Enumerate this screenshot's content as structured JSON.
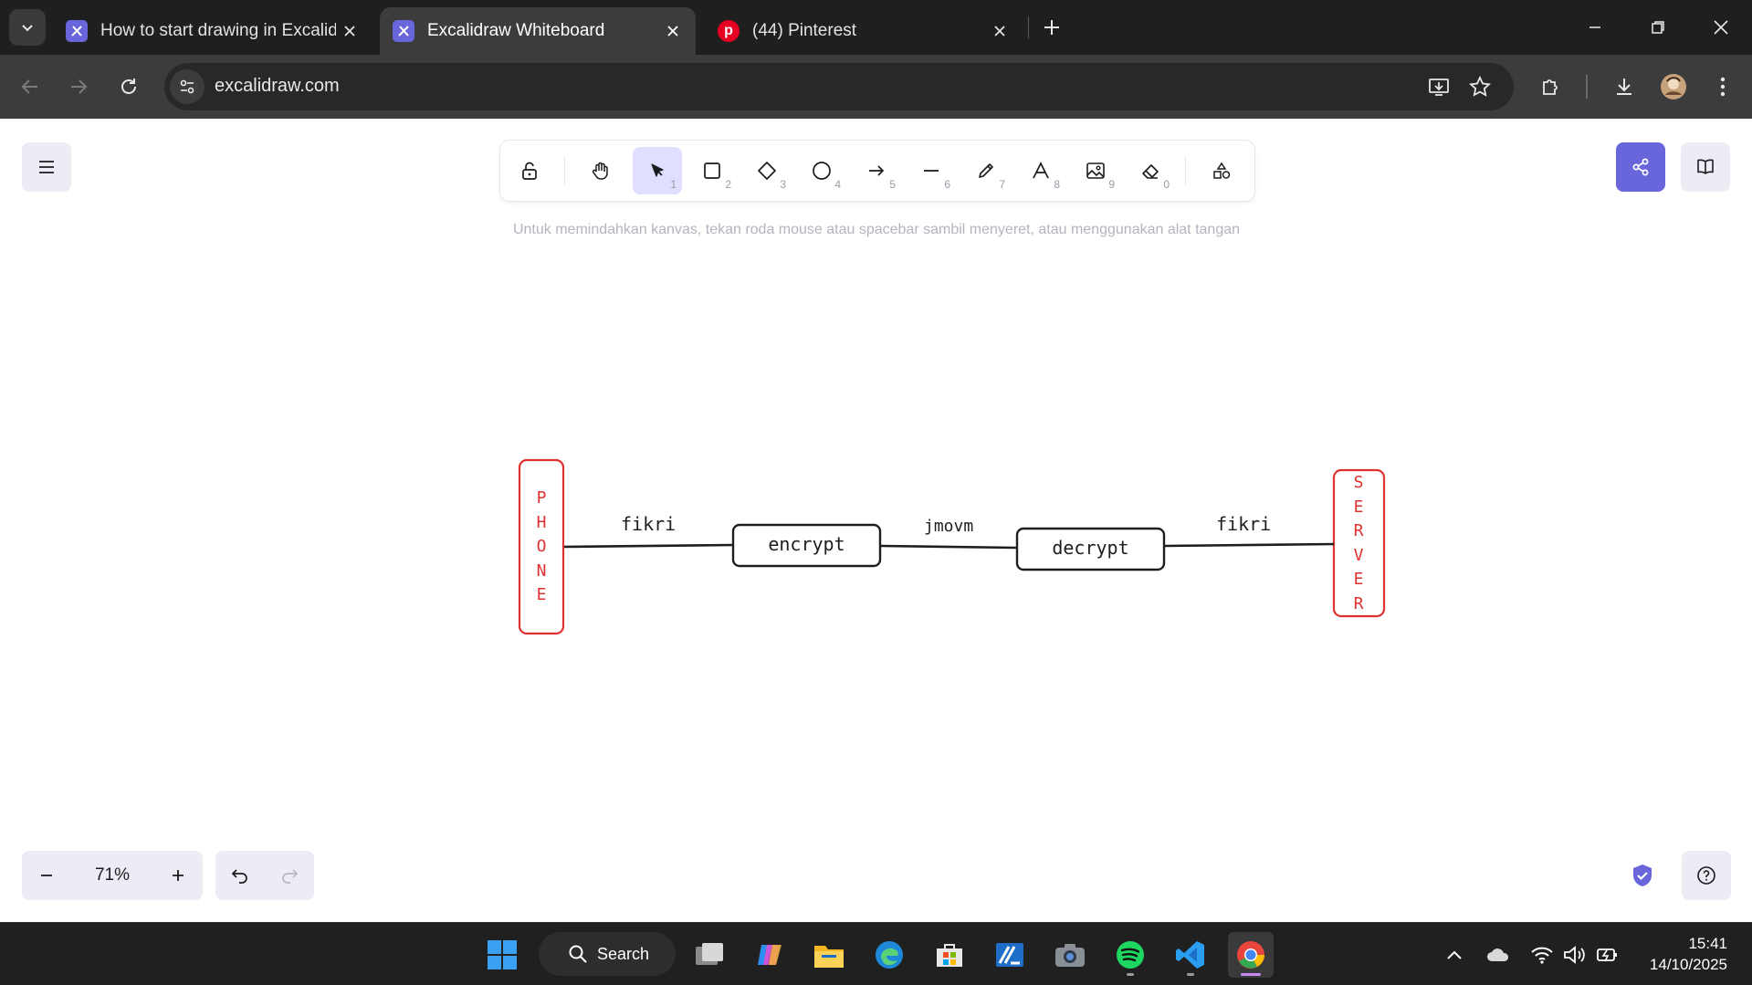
{
  "browser": {
    "tabs": [
      {
        "title": "How to start drawing in Excalid",
        "active": false
      },
      {
        "title": "Excalidraw Whiteboard",
        "active": true
      },
      {
        "title": "(44) Pinterest",
        "active": false
      }
    ],
    "url": "excalidraw.com"
  },
  "excalidraw": {
    "tools": [
      {
        "name": "lock",
        "key": ""
      },
      {
        "name": "hand",
        "key": ""
      },
      {
        "name": "selection",
        "key": "1",
        "selected": true
      },
      {
        "name": "rectangle",
        "key": "2"
      },
      {
        "name": "diamond",
        "key": "3"
      },
      {
        "name": "ellipse",
        "key": "4"
      },
      {
        "name": "arrow",
        "key": "5"
      },
      {
        "name": "line",
        "key": "6"
      },
      {
        "name": "draw",
        "key": "7"
      },
      {
        "name": "text",
        "key": "8"
      },
      {
        "name": "image",
        "key": "9"
      },
      {
        "name": "eraser",
        "key": "0"
      },
      {
        "name": "more-shapes",
        "key": ""
      }
    ],
    "hint": "Untuk memindahkan kanvas, tekan roda mouse atau spacebar sambil menyeret, atau menggunakan alat tangan",
    "zoom": "71%",
    "diagram": {
      "phone_letters": [
        "P",
        "H",
        "O",
        "N",
        "E"
      ],
      "server_letters": [
        "S",
        "E",
        "R",
        "V",
        "E",
        "R"
      ],
      "box1": "encrypt",
      "box2": "decrypt",
      "label1": "fikri",
      "label2": "jmovm",
      "label3": "fikri",
      "stroke_color": "#1e1e1e",
      "red_color": "#e03131"
    }
  },
  "taskbar": {
    "search_label": "Search",
    "time": "15:41",
    "date": "14/10/2025"
  },
  "colors": {
    "accent": "#6965db",
    "chrome_dark": "#1f1f1f"
  }
}
